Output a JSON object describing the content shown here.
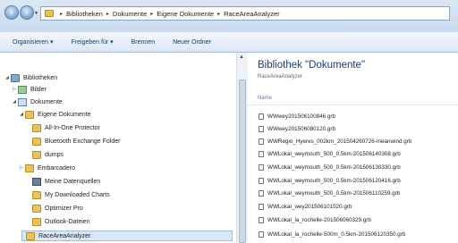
{
  "address": {
    "crumbs": [
      "Bibliotheken",
      "Dokumente",
      "Eigene Dokumente",
      "RaceAreaAnalyzer"
    ]
  },
  "toolbar": {
    "organize": "Organisieren ▾",
    "share": "Freigeben für ▾",
    "burn": "Brennen",
    "new_folder": "Neuer Ordner"
  },
  "tree": {
    "items": [
      {
        "label": "Bibliotheken"
      },
      {
        "label": "Bilder"
      },
      {
        "label": "Dokumente"
      },
      {
        "label": "Eigene Dokumente"
      },
      {
        "label": "All-In-One Protector"
      },
      {
        "label": "Bluetooth Exchange Folder"
      },
      {
        "label": "dumps"
      },
      {
        "label": "Embarcadero"
      },
      {
        "label": "Meine Datenquellen"
      },
      {
        "label": "My Downloaded Charts"
      },
      {
        "label": "Optimizer Pro"
      },
      {
        "label": "Outlook-Dateien"
      },
      {
        "label": "RaceAreaAnalyzer"
      }
    ]
  },
  "content": {
    "title": "Bibliothek \"Dokumente\"",
    "subtitle": "RaceAreaAnalyzer",
    "column_name": "Name",
    "files": [
      "WWwey201506100846.grb",
      "WWwey201506080120.grb",
      "WWRegio_Hyeres_002km_201504260726-meanwind.grb",
      "WWLokal_weymouth_500_0.5km-201506140308.grb",
      "WWLokal_weymouth_500_0.5km-201506130330.grb",
      "WWLokal_weymouth_500_0.5km-201506120416.grb",
      "WWLokal_weymouth_500_0.5km-201506110259.grb",
      "WWLokal_wey201506101520.grb",
      "WWLokal_la_rochelle-201506060329.grb",
      "WWLokal_la_rochelle-500m_0.5km-201506120350.grb"
    ]
  }
}
